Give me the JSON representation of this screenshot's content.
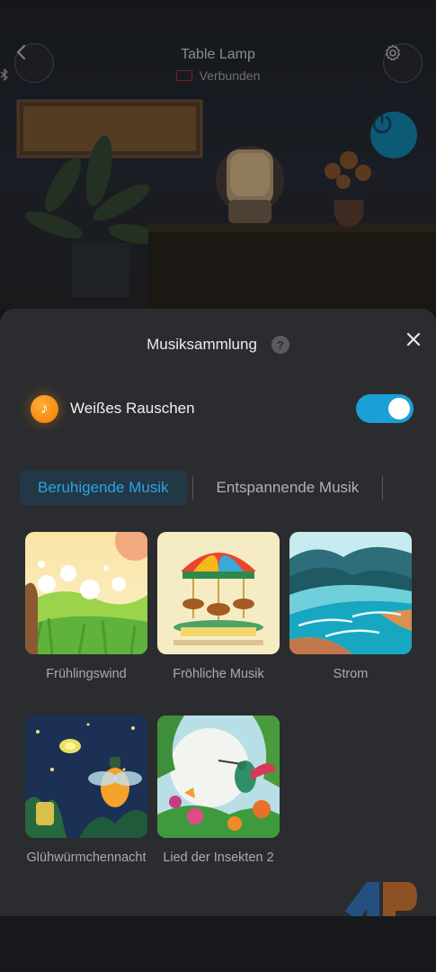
{
  "device": {
    "title": "Table Lamp",
    "status": "Verbunden",
    "accent": "#0c5a76"
  },
  "sheet": {
    "title": "Musiksammlung",
    "help": "?",
    "white_noise": {
      "label": "Weißes Rauschen",
      "enabled": true,
      "toggle_color": "#1a9fd6"
    },
    "tabs": [
      {
        "label": "Beruhigende Musik",
        "active": true
      },
      {
        "label": "Entspannende Musik",
        "active": false
      }
    ],
    "tracks": [
      {
        "title": "Frühlingswind",
        "icon": "dandelion-meadow-art"
      },
      {
        "title": "Fröhliche Musik",
        "icon": "carousel-art"
      },
      {
        "title": "Strom",
        "icon": "river-art"
      },
      {
        "title": "Glühwürmchennacht",
        "icon": "firefly-night-art"
      },
      {
        "title": "Lied der Insekten 2",
        "icon": "hummingbird-art"
      }
    ]
  }
}
